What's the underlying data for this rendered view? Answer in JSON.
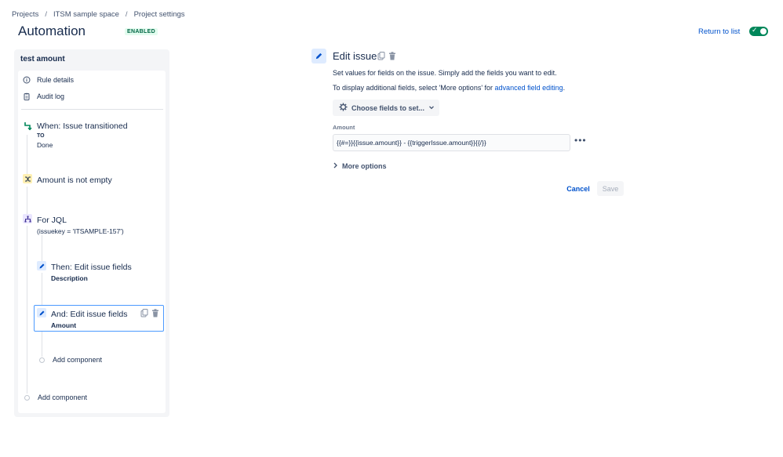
{
  "breadcrumb": {
    "items": [
      "Projects",
      "ITSM sample space",
      "Project settings"
    ],
    "separator": "/"
  },
  "header": {
    "title": "Automation",
    "status_badge": "ENABLED",
    "return_link": "Return to list",
    "toggle_on": true,
    "toggle_color": "#00875a"
  },
  "rule": {
    "name": "test amount",
    "menu": [
      {
        "label": "Rule details",
        "icon": "info-icon"
      },
      {
        "label": "Audit log",
        "icon": "clipboard-icon"
      }
    ],
    "trigger": {
      "title": "When: Issue transitioned",
      "to_label": "TO",
      "to_value": "Done",
      "icon": "transition-icon"
    },
    "condition": {
      "title": "Amount is not empty",
      "icon": "shuffle-icon"
    },
    "branch": {
      "title": "For JQL",
      "sub": "(issuekey = 'ITSAMPLE-157')",
      "icon": "branch-icon"
    },
    "actions": [
      {
        "title": "Then: Edit issue fields",
        "sub": "Description",
        "icon": "pencil-icon"
      },
      {
        "title": "And: Edit issue fields",
        "sub": "Amount",
        "icon": "pencil-icon",
        "selected": true
      }
    ],
    "add_component_inner": "Add component",
    "add_component_outer": "Add component"
  },
  "editor": {
    "title": "Edit issue",
    "description": "Set values for fields on the issue. Simply add the fields you want to edit.",
    "additional_prefix": "To display additional fields, select 'More options' for ",
    "additional_link": "advanced field editing",
    "additional_suffix": ".",
    "choose_fields_label": "Choose fields to set...",
    "field": {
      "label": "Amount",
      "value": "{{#=}}{{issue.amount}} - {{triggerIssue.amount}}{{/}}"
    },
    "more_options_label": "More options",
    "cancel_label": "Cancel",
    "save_label": "Save"
  },
  "colors": {
    "accent": "#0052cc",
    "selected_border": "#4c9aff",
    "enabled_badge": "#006644"
  }
}
